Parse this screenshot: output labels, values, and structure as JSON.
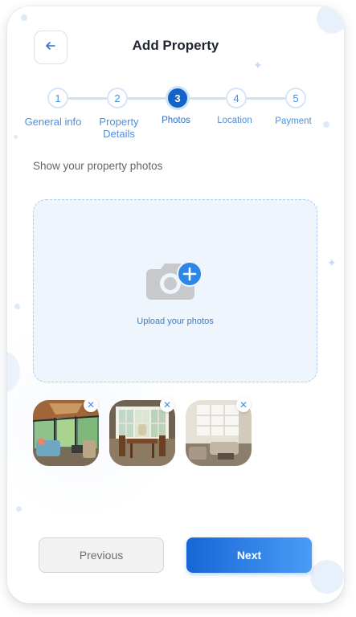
{
  "header": {
    "title": "Add Property",
    "back_icon": "arrow-left-icon"
  },
  "stepper": {
    "steps": [
      {
        "number": "1",
        "label": "General info",
        "state": "done"
      },
      {
        "number": "2",
        "label": "Property Details",
        "state": "done"
      },
      {
        "number": "3",
        "label": "Photos",
        "state": "active"
      },
      {
        "number": "4",
        "label": "Location",
        "state": "pending"
      },
      {
        "number": "5",
        "label": "Payment",
        "state": "pending"
      }
    ],
    "current_step": 3,
    "total_steps": 5
  },
  "photos": {
    "subtitle": "Show your property photos",
    "upload_label": "Upload your photos",
    "upload_icon": "camera-add-icon",
    "thumbnails": [
      {
        "name": "sunroom-photo",
        "remove_icon": "close-icon"
      },
      {
        "name": "dining-room-photo",
        "remove_icon": "close-icon"
      },
      {
        "name": "living-room-photo",
        "remove_icon": "close-icon"
      }
    ]
  },
  "footer": {
    "previous_label": "Previous",
    "next_label": "Next"
  },
  "colors": {
    "primary": "#1363c9",
    "accent_light": "#4b9cf6",
    "dropzone_bg": "#eef5fd",
    "title_text": "#1f2430"
  }
}
